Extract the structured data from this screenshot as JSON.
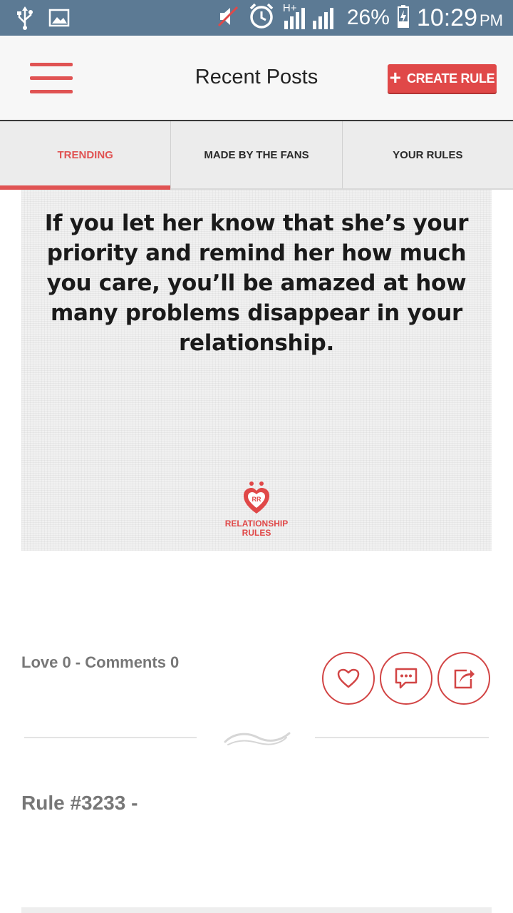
{
  "status_bar": {
    "icons": [
      "usb-icon",
      "gallery-icon",
      "mute-icon",
      "alarm-icon",
      "signal-icon"
    ],
    "network": "H+",
    "battery": "26%",
    "time": "10:29",
    "ampm": "PM"
  },
  "header": {
    "title": "Recent Posts",
    "create_button": "CREATE RULE",
    "menu_icon": "hamburger-menu-icon"
  },
  "tabs": [
    {
      "label": "TRENDING",
      "active": true
    },
    {
      "label": "MADE BY THE FANS",
      "active": false
    },
    {
      "label": "YOUR RULES",
      "active": false
    }
  ],
  "post": {
    "quote": "If you let her know that she’s your priority and remind her how much you care, you’ll be amazed at how many problems disappear in your relationship.",
    "brand_line1": "RELATIONSHIP",
    "brand_line2": "RULES",
    "logo_initials": "RR",
    "stats": "Love 0 - Comments 0",
    "actions": [
      "heart-icon",
      "comment-icon",
      "share-icon"
    ]
  },
  "next_post": {
    "title": "Rule #3233 -"
  },
  "colors": {
    "accent": "#e05353",
    "status_bar": "#5c7a94",
    "muted_text": "#777777"
  }
}
